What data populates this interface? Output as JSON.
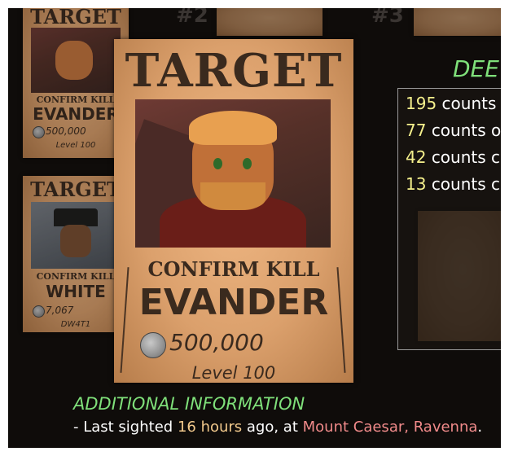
{
  "background_ranks": {
    "rank2": "#2",
    "rank3": "#3"
  },
  "side_posters": [
    {
      "title": "TARGET",
      "confirm": "CONFIRM KILL",
      "name": "EVANDER",
      "bounty": "500,000",
      "level": "Level 100"
    },
    {
      "title": "TARGET",
      "confirm": "CONFIRM KILL",
      "name": "WHITE",
      "bounty": "7,067",
      "level": "DW4T1"
    }
  ],
  "main_poster": {
    "title": "TARGET",
    "confirm": "CONFIRM KILL",
    "name": "EVANDER",
    "bounty": "500,000",
    "level": "Level 100"
  },
  "stats_panel": {
    "heading": "DEE",
    "rows": [
      {
        "count": "195",
        "text": "counts"
      },
      {
        "count": "77",
        "text": "counts o"
      },
      {
        "count": "42",
        "text": "counts c"
      },
      {
        "count": "13",
        "text": "counts c"
      }
    ]
  },
  "info": {
    "heading": "ADDITIONAL INFORMATION",
    "prefix": "- Last sighted ",
    "hours": "16 hours",
    "middle": " ago, at ",
    "location": "Mount Caesar, Ravenna",
    "suffix": "."
  },
  "colors": {
    "accent_green": "#7fe07a",
    "count_yellow": "#f5f08c",
    "location_red": "#f08a8a",
    "hours_orange": "#f2c98c",
    "poster_paper": "#dba06c"
  }
}
